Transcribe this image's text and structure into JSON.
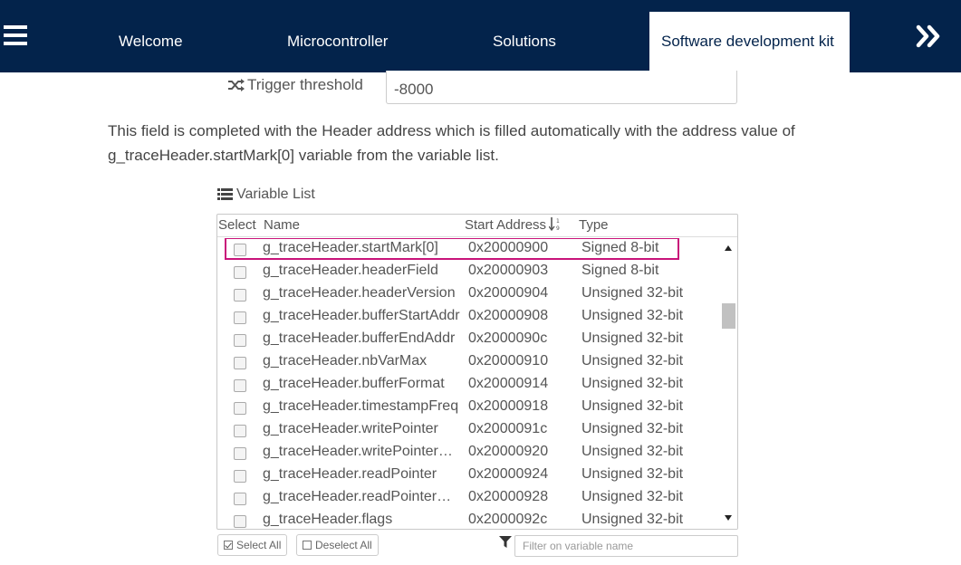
{
  "nav": {
    "tabs": [
      {
        "label": "Welcome",
        "active": false
      },
      {
        "label": "Microcontroller",
        "active": false
      },
      {
        "label": "Solutions",
        "active": false
      },
      {
        "label": "Software development kit",
        "active": true
      }
    ],
    "menu_icon": "hamburger-icon",
    "next_icon": "double-chevron-right-icon"
  },
  "trigger": {
    "label": "Trigger threshold",
    "value": "-8000",
    "icon": "shuffle-icon"
  },
  "description": "This field is completed with the Header address which is filled automatically with the address value of g_traceHeader.startMark[0] variable from the variable list.",
  "variable_list": {
    "title": "Variable List",
    "icon": "list-icon",
    "columns": {
      "select": "Select",
      "name": "Name",
      "address": "Start Address",
      "type": "Type"
    },
    "sort_icon": "sort-numeric-asc-icon",
    "rows": [
      {
        "name": "g_traceHeader.startMark[0]",
        "address": "0x20000900",
        "type": "Signed 8-bit",
        "highlighted": true
      },
      {
        "name": "g_traceHeader.headerField",
        "address": "0x20000903",
        "type": "Signed 8-bit"
      },
      {
        "name": "g_traceHeader.headerVersion",
        "address": "0x20000904",
        "type": "Unsigned 32-bit"
      },
      {
        "name": "g_traceHeader.bufferStartAddr",
        "address": "0x20000908",
        "type": "Unsigned 32-bit"
      },
      {
        "name": "g_traceHeader.bufferEndAddr",
        "address": "0x2000090c",
        "type": "Unsigned 32-bit"
      },
      {
        "name": "g_traceHeader.nbVarMax",
        "address": "0x20000910",
        "type": "Unsigned 32-bit"
      },
      {
        "name": "g_traceHeader.bufferFormat",
        "address": "0x20000914",
        "type": "Unsigned 32-bit"
      },
      {
        "name": "g_traceHeader.timestampFreq",
        "address": "0x20000918",
        "type": "Unsigned 32-bit"
      },
      {
        "name": "g_traceHeader.writePointer",
        "address": "0x2000091c",
        "type": "Unsigned 32-bit"
      },
      {
        "name": "g_traceHeader.writePointerWrap",
        "address": "0x20000920",
        "type": "Unsigned 32-bit"
      },
      {
        "name": "g_traceHeader.readPointer",
        "address": "0x20000924",
        "type": "Unsigned 32-bit"
      },
      {
        "name": "g_traceHeader.readPointerWrap",
        "address": "0x20000928",
        "type": "Unsigned 32-bit"
      },
      {
        "name": "g_traceHeader.flags",
        "address": "0x2000092c",
        "type": "Unsigned 32-bit"
      }
    ],
    "select_all_label": "Select All",
    "deselect_all_label": "Deselect All",
    "filter_icon": "filter-icon",
    "filter_placeholder": "Filter on variable name",
    "filter_value": ""
  },
  "colors": {
    "nav_bg": "#03234b",
    "highlight_border": "#c8147a"
  }
}
